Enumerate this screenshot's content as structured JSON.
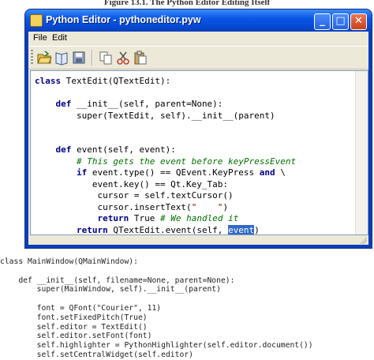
{
  "figure_caption": "Figure 13.1. The Python Editor Editing Itself",
  "window": {
    "title": "Python Editor - pythoneditor.pyw",
    "buttons": {
      "minimize": "_",
      "maximize": "□",
      "close": "✕"
    }
  },
  "menu": {
    "file": "File",
    "edit": "Edit"
  },
  "toolbar": {
    "icons": [
      "file-open-icon",
      "file-open-book-icon",
      "file-save-icon",
      "copy-icon",
      "cut-icon",
      "paste-icon"
    ]
  },
  "editor": {
    "lines": [
      [
        {
          "t": "class",
          "c": "kw"
        },
        {
          "t": " TextEdit(QTextEdit):"
        }
      ],
      [
        {
          "t": ""
        }
      ],
      [
        {
          "t": "    "
        },
        {
          "t": "def",
          "c": "kw"
        },
        {
          "t": " __init__(self, parent=None):"
        }
      ],
      [
        {
          "t": "        super(TextEdit, self).__init__(parent)"
        }
      ],
      [
        {
          "t": ""
        }
      ],
      [
        {
          "t": ""
        }
      ],
      [
        {
          "t": "    "
        },
        {
          "t": "def",
          "c": "kw"
        },
        {
          "t": " event(self, event):"
        }
      ],
      [
        {
          "t": "        "
        },
        {
          "t": "# This gets the event before keyPressEvent",
          "c": "cm"
        }
      ],
      [
        {
          "t": "        "
        },
        {
          "t": "if",
          "c": "kw"
        },
        {
          "t": " event.type() == QEvent.KeyPress "
        },
        {
          "t": "and",
          "c": "kw"
        },
        {
          "t": " \\"
        }
      ],
      [
        {
          "t": "           event.key() == Qt.Key_Tab:"
        }
      ],
      [
        {
          "t": "            cursor = self.textCursor()"
        }
      ],
      [
        {
          "t": "            cursor.insertText("
        },
        {
          "t": "\"    \"",
          "c": "st"
        },
        {
          "t": ")"
        }
      ],
      [
        {
          "t": "            "
        },
        {
          "t": "return",
          "c": "kw"
        },
        {
          "t": " True "
        },
        {
          "t": "# We handled it",
          "c": "cm"
        }
      ],
      [
        {
          "t": "        "
        },
        {
          "t": "return",
          "c": "kw"
        },
        {
          "t": " QTextEdit.event(self, "
        },
        {
          "t": "event",
          "c": "sel"
        },
        {
          "t": ")"
        }
      ]
    ]
  },
  "below_code": [
    "class MainWindow(QMainWindow):",
    "",
    "    def __init__(self, filename=None, parent=None):",
    "        super(MainWindow, self).__init__(parent)",
    "",
    "        font = QFont(\"Courier\", 11)",
    "        font.setFixedPitch(True)",
    "        self.editor = TextEdit()",
    "        self.editor.setFont(font)",
    "        self.highlighter = PythonHighlighter(self.editor.document())",
    "        self.setCentralWidget(self.editor)"
  ]
}
